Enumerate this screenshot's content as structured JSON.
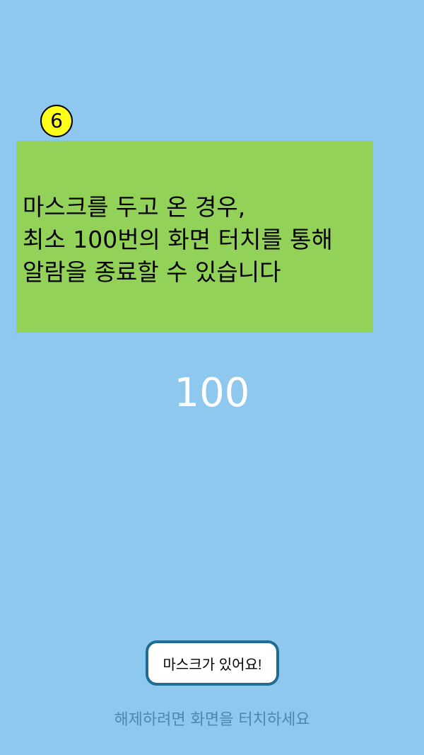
{
  "step": {
    "number": "6"
  },
  "info": {
    "lines": [
      "마스크를 두고 온 경우,",
      "최소 100번의 화면 터치를 통해",
      "알람을 종료할 수 있습니다"
    ]
  },
  "counter": {
    "value": "100"
  },
  "mask_button": {
    "label": "마스크가 있어요!"
  },
  "hint": {
    "text": "해제하려면 화면을 터치하세요"
  },
  "colors": {
    "background": "#8fc8ee",
    "info_box": "#92d258",
    "badge": "#ffff1a",
    "button_border": "#1f6d92",
    "hint_text": "#4f86b1"
  }
}
